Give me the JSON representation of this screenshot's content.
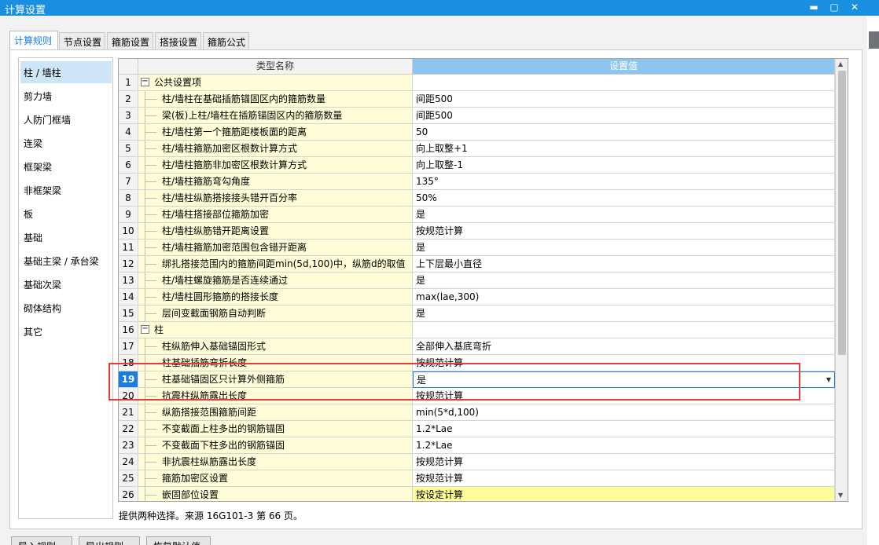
{
  "window": {
    "title": "计算设置"
  },
  "tabs": [
    {
      "label": "计算规则",
      "active": true
    },
    {
      "label": "节点设置"
    },
    {
      "label": "箍筋设置"
    },
    {
      "label": "搭接设置"
    },
    {
      "label": "箍筋公式"
    }
  ],
  "left_items": [
    "柱 / 墙柱",
    "剪力墙",
    "人防门框墙",
    "连梁",
    "框架梁",
    "非框架梁",
    "板",
    "基础",
    "基础主梁 / 承台梁",
    "基础次梁",
    "砌体结构",
    "其它"
  ],
  "grid": {
    "headers": {
      "name": "类型名称",
      "value": "设置值"
    },
    "rows": [
      {
        "n": "1",
        "name": "公共设置项",
        "value": "",
        "group": true
      },
      {
        "n": "2",
        "name": "柱/墙柱在基础插筋锚固区内的箍筋数量",
        "value": "间距500"
      },
      {
        "n": "3",
        "name": "梁(板)上柱/墙柱在插筋锚固区内的箍筋数量",
        "value": "间距500"
      },
      {
        "n": "4",
        "name": "柱/墙柱第一个箍筋距楼板面的距离",
        "value": "50"
      },
      {
        "n": "5",
        "name": "柱/墙柱箍筋加密区根数计算方式",
        "value": "向上取整+1"
      },
      {
        "n": "6",
        "name": "柱/墙柱箍筋非加密区根数计算方式",
        "value": "向上取整-1"
      },
      {
        "n": "7",
        "name": "柱/墙柱箍筋弯勾角度",
        "value": "135°"
      },
      {
        "n": "8",
        "name": "柱/墙柱纵筋搭接接头错开百分率",
        "value": "50%"
      },
      {
        "n": "9",
        "name": "柱/墙柱搭接部位箍筋加密",
        "value": "是"
      },
      {
        "n": "10",
        "name": "柱/墙柱纵筋错开距离设置",
        "value": "按规范计算"
      },
      {
        "n": "11",
        "name": "柱/墙柱箍筋加密范围包含错开距离",
        "value": "是"
      },
      {
        "n": "12",
        "name": "绑扎搭接范围内的箍筋间距min(5d,100)中，纵筋d的取值",
        "value": "上下层最小直径"
      },
      {
        "n": "13",
        "name": "柱/墙柱螺旋箍筋是否连续通过",
        "value": "是"
      },
      {
        "n": "14",
        "name": "柱/墙柱圆形箍筋的搭接长度",
        "value": "max(lae,300)"
      },
      {
        "n": "15",
        "name": "层间变截面钢筋自动判断",
        "value": "是"
      },
      {
        "n": "16",
        "name": "柱",
        "value": "",
        "group": true
      },
      {
        "n": "17",
        "name": "柱纵筋伸入基础锚固形式",
        "value": "全部伸入基底弯折"
      },
      {
        "n": "18",
        "name": "柱基础插筋弯折长度",
        "value": "按规范计算"
      },
      {
        "n": "19",
        "name": "柱基础锚固区只计算外侧箍筋",
        "value": "是",
        "selected": true
      },
      {
        "n": "20",
        "name": "抗震柱纵筋露出长度",
        "value": "按规范计算"
      },
      {
        "n": "21",
        "name": "纵筋搭接范围箍筋间距",
        "value": "min(5*d,100)"
      },
      {
        "n": "22",
        "name": "不变截面上柱多出的钢筋锚固",
        "value": "1.2*Lae"
      },
      {
        "n": "23",
        "name": "不变截面下柱多出的钢筋锚固",
        "value": "1.2*Lae"
      },
      {
        "n": "24",
        "name": "非抗震柱纵筋露出长度",
        "value": "按规范计算"
      },
      {
        "n": "25",
        "name": "箍筋加密区设置",
        "value": "按规范计算"
      },
      {
        "n": "26",
        "name": "嵌固部位设置",
        "value": "按设定计算",
        "yellow": true
      }
    ]
  },
  "hint": "提供两种选择。来源 16G101-3 第 66 页。",
  "buttons": [
    "导入规则",
    "导出规则",
    "恢复默认值"
  ],
  "colors": {
    "accent": "#1a8fe0",
    "header_value_bg": "#8cc6f0",
    "name_cell_bg": "#fffdd7",
    "highlight_border": "#e83a3a"
  }
}
